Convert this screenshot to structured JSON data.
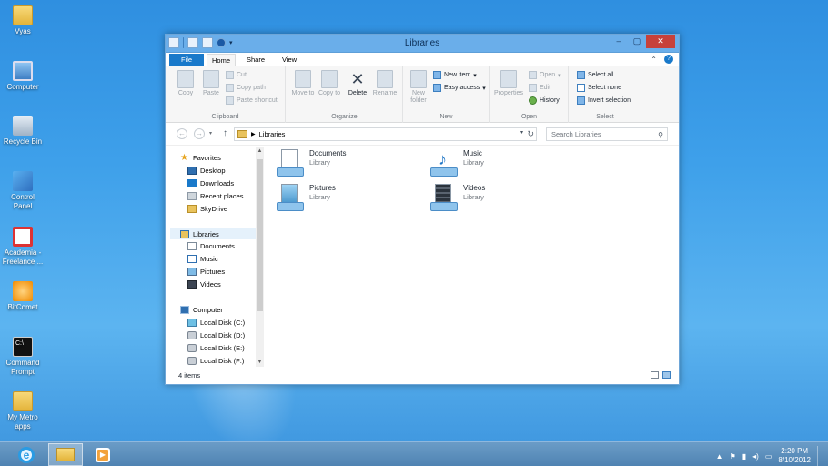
{
  "desktop": {
    "icons": [
      {
        "label": "Vyas",
        "icon": "user-folder-icon"
      },
      {
        "label": "Computer",
        "icon": "computer-icon"
      },
      {
        "label": "Recycle Bin",
        "icon": "recycle-bin-icon"
      },
      {
        "label": "Control Panel",
        "icon": "control-panel-icon"
      },
      {
        "label": "Academia - Freelance ...",
        "icon": "acrobat-shortcut-icon"
      },
      {
        "label": "BitComet",
        "icon": "bitcomet-icon"
      },
      {
        "label": "Command Prompt",
        "icon": "command-prompt-icon"
      },
      {
        "label": "My Metro apps",
        "icon": "folder-icon"
      }
    ]
  },
  "window": {
    "title": "Libraries",
    "controls": {
      "minimize": "–",
      "maximize": "▢",
      "close": "✕"
    }
  },
  "ribbon_tabs": {
    "file": "File",
    "home": "Home",
    "share": "Share",
    "view": "View"
  },
  "ribbon": {
    "clipboard": {
      "label": "Clipboard",
      "copy": "Copy",
      "paste": "Paste",
      "cut": "Cut",
      "copy_path": "Copy path",
      "paste_shortcut": "Paste shortcut"
    },
    "organize": {
      "label": "Organize",
      "move_to": "Move to",
      "copy_to": "Copy to",
      "delete": "Delete",
      "rename": "Rename"
    },
    "new": {
      "label": "New",
      "new_folder": "New folder",
      "new_item": "New item",
      "easy_access": "Easy access"
    },
    "open": {
      "label": "Open",
      "properties": "Properties",
      "open": "Open",
      "edit": "Edit",
      "history": "History"
    },
    "select": {
      "label": "Select",
      "select_all": "Select all",
      "select_none": "Select none",
      "invert_selection": "Invert selection"
    }
  },
  "address": {
    "path": "Libraries",
    "search_placeholder": "Search Libraries"
  },
  "nav": {
    "favorites": "Favorites",
    "desktop": "Desktop",
    "downloads": "Downloads",
    "recent_places": "Recent places",
    "skydrive": "SkyDrive",
    "libraries": "Libraries",
    "documents": "Documents",
    "music": "Music",
    "pictures": "Pictures",
    "videos": "Videos",
    "computer": "Computer",
    "disk_c": "Local Disk (C:)",
    "disk_d": "Local Disk (D:)",
    "disk_e": "Local Disk (E:)",
    "disk_f": "Local Disk (F:)"
  },
  "libraries": [
    {
      "name": "Documents",
      "type": "Library"
    },
    {
      "name": "Music",
      "type": "Library"
    },
    {
      "name": "Pictures",
      "type": "Library"
    },
    {
      "name": "Videos",
      "type": "Library"
    }
  ],
  "status": {
    "items": "4 items"
  },
  "taskbar": {
    "time": "2:20 PM",
    "date": "8/10/2012"
  }
}
